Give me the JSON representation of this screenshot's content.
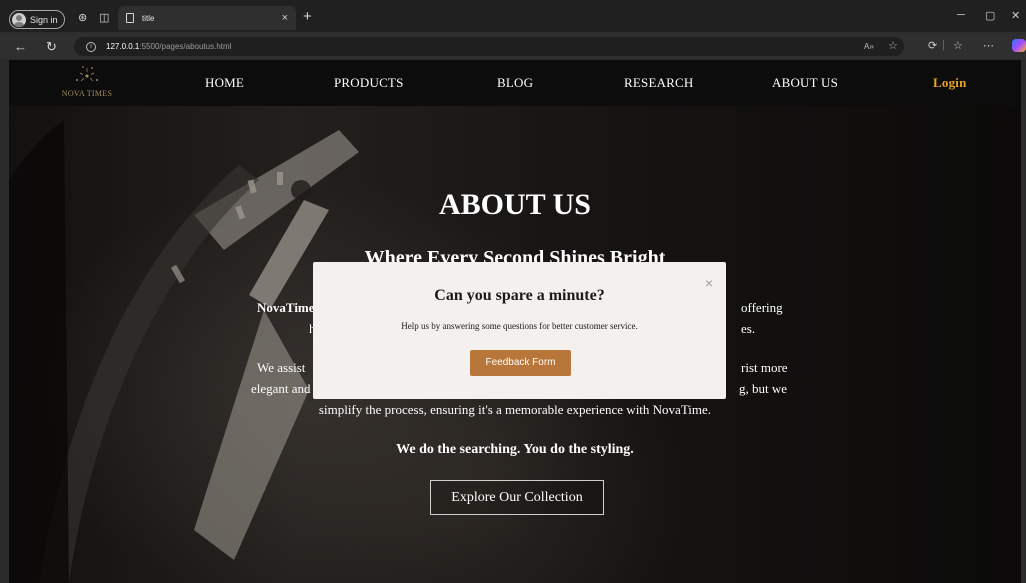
{
  "browser": {
    "signin_label": "Sign in",
    "tab_title": "title",
    "tab_close": "×",
    "new_tab": "+",
    "url_host": "127.0.0.1",
    "url_path": ":5500/pages/aboutus.html",
    "icons": [
      "back-arrow-icon",
      "reload-icon",
      "info-icon",
      "read-aloud-icon",
      "favorites-star-icon",
      "copilot-icon",
      "extensions-icon",
      "more-icon"
    ]
  },
  "site": {
    "logo_text": "NOVA TIMES",
    "nav": {
      "home": "HOME",
      "products": "PRODUCTS",
      "blog": "BLOG",
      "research": "RESEARCH",
      "about": "ABOUT US",
      "login": "Login"
    },
    "hero": {
      "title": "ABOUT US",
      "subtitle": "Where Every Second Shines Bright",
      "p1_strong": "NovaTime",
      "p1_left": "high",
      "p1_right1": "offering",
      "p1_right2": "es.",
      "p2_l1_left": "We assist",
      "p2_l1_right": "rist more",
      "p2_l2_left": "elegant and",
      "p2_l2_right": "g, but we",
      "p2_l3": "simplify the process, ensuring it's a memorable experience with NovaTime.",
      "tagline": "We do the searching. You do the styling.",
      "cta": "Explore Our Collection"
    }
  },
  "modal": {
    "title": "Can you spare a minute?",
    "text": "Help us by answering some questions for better customer service.",
    "button": "Feedback Form",
    "close": "×"
  },
  "colors": {
    "accent_gold": "#e6a526",
    "feedback_button": "#b8763a",
    "modal_bg": "#f3f0ed"
  }
}
